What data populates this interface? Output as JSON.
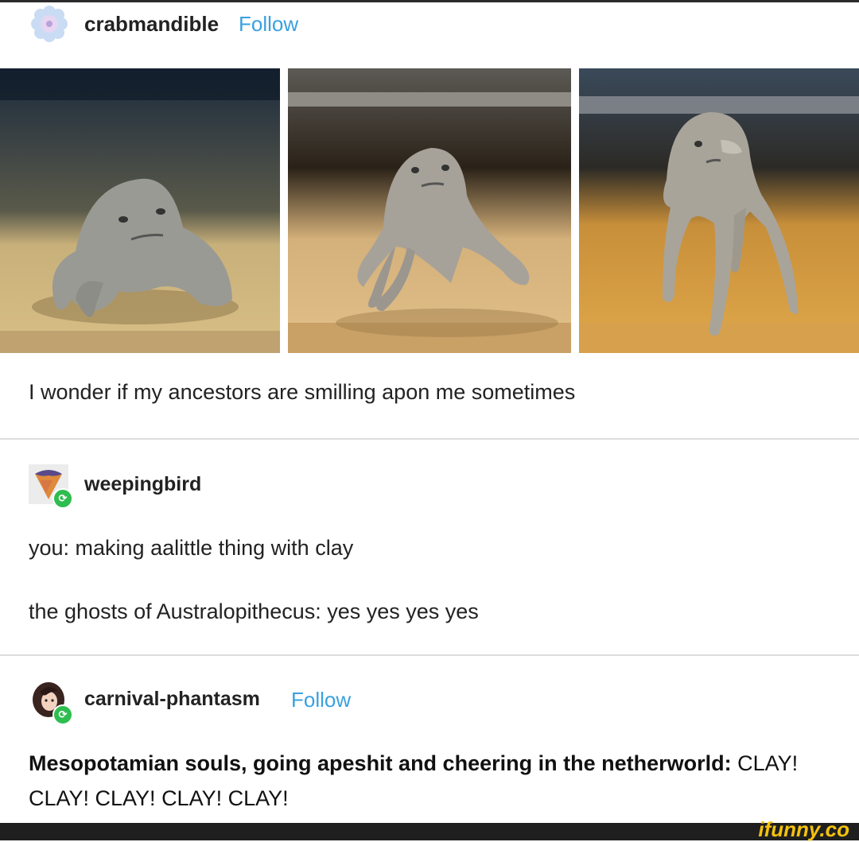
{
  "post1": {
    "username": "crabmandible",
    "follow_label": "Follow",
    "photos": [
      {
        "name": "clay-creature-photo-1"
      },
      {
        "name": "clay-creature-photo-2"
      },
      {
        "name": "clay-creature-photo-3"
      }
    ],
    "caption": "I wonder if my ancestors are smilling apon me sometimes"
  },
  "reblog1": {
    "username": "weepingbird",
    "lines": [
      "you: making aalittle thing with clay",
      "the ghosts of Australopithecus: yes yes yes yes"
    ]
  },
  "reblog2": {
    "username": "carnival-phantasm",
    "follow_label": "Follow",
    "bold_part": "Mesopotamian souls, going apeshit and cheering in the netherworld:",
    "normal_part": " CLAY! CLAY! CLAY! CLAY! CLAY!"
  },
  "watermark": "ifunny.co",
  "colors": {
    "follow": "#3aa0e0",
    "reblog_badge": "#2ebd4f",
    "watermark": "#f4c20d"
  }
}
